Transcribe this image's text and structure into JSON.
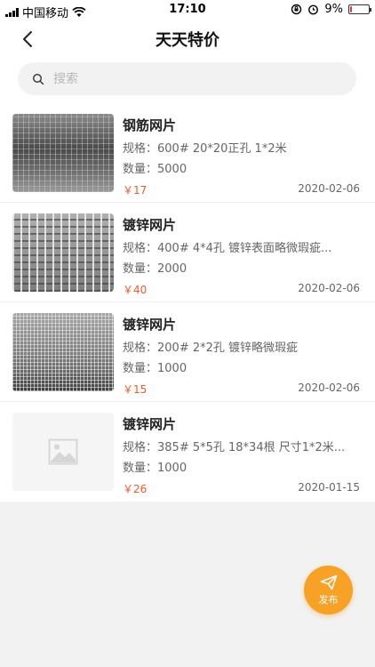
{
  "status_bar": {
    "carrier": "中国移动",
    "time": "17:10",
    "battery": "9%",
    "battery_level": 0.09
  },
  "nav": {
    "title": "天天特价"
  },
  "search": {
    "placeholder": "搜索"
  },
  "items": [
    {
      "name": "钢筋网片",
      "spec": "规格：600# 20*20正孔 1*2米",
      "qty": "数量：5000",
      "price": "￥17",
      "date": "2020-02-06"
    },
    {
      "name": "镀锌网片",
      "spec": "规格：400# 4*4孔  镀锌表面略微瑕疵...",
      "qty": "数量：2000",
      "price": "￥40",
      "date": "2020-02-06"
    },
    {
      "name": "镀锌网片",
      "spec": "规格：200# 2*2孔  镀锌略微瑕疵",
      "qty": "数量：1000",
      "price": "￥15",
      "date": "2020-02-06"
    },
    {
      "name": "镀锌网片",
      "spec": "规格：385#  5*5孔  18*34根 尺寸1*2米...",
      "qty": "数量：1000",
      "price": "￥26",
      "date": "2020-01-15"
    }
  ],
  "fab": {
    "label": "发布"
  },
  "colors": {
    "accent": "#f7a127",
    "price": "#f05a2a"
  }
}
